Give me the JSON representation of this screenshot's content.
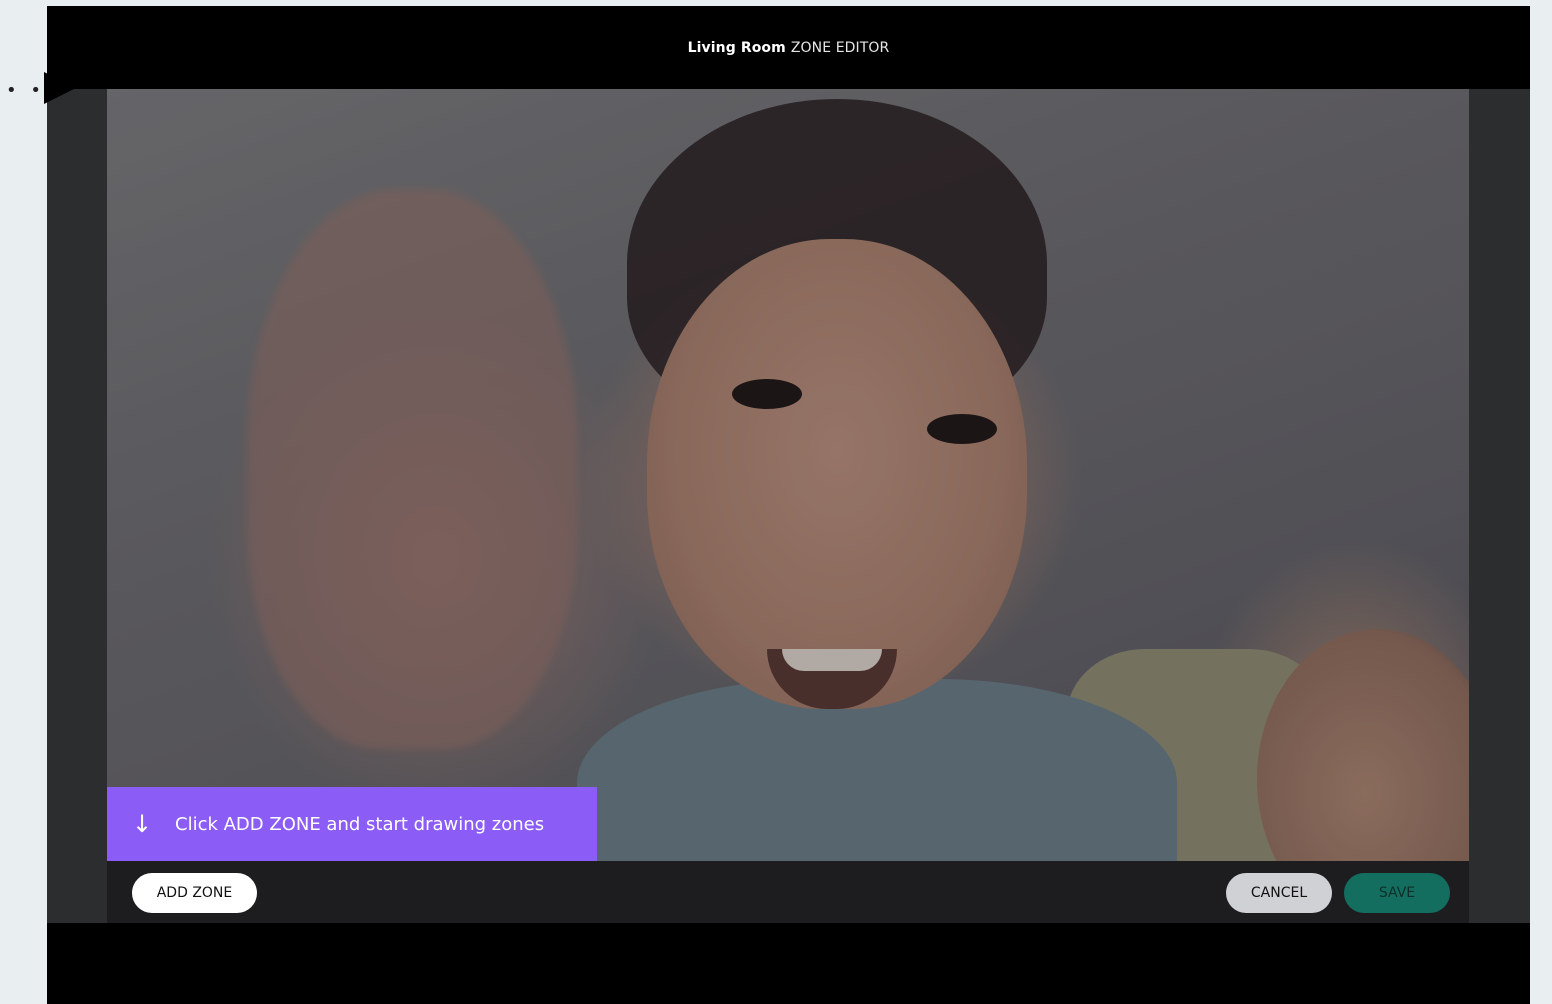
{
  "window": {
    "room_name": "Living Room",
    "subtitle": "ZONE EDITOR"
  },
  "video": {
    "description_icon": "camera-feed"
  },
  "hint": {
    "icon": "arrow-down-icon",
    "text": "Click ADD ZONE and start drawing zones",
    "color": "#8b5cf6"
  },
  "toolbar": {
    "add_zone_label": "ADD ZONE",
    "cancel_label": "CANCEL",
    "save_label": "SAVE",
    "save_color": "#146e60"
  }
}
